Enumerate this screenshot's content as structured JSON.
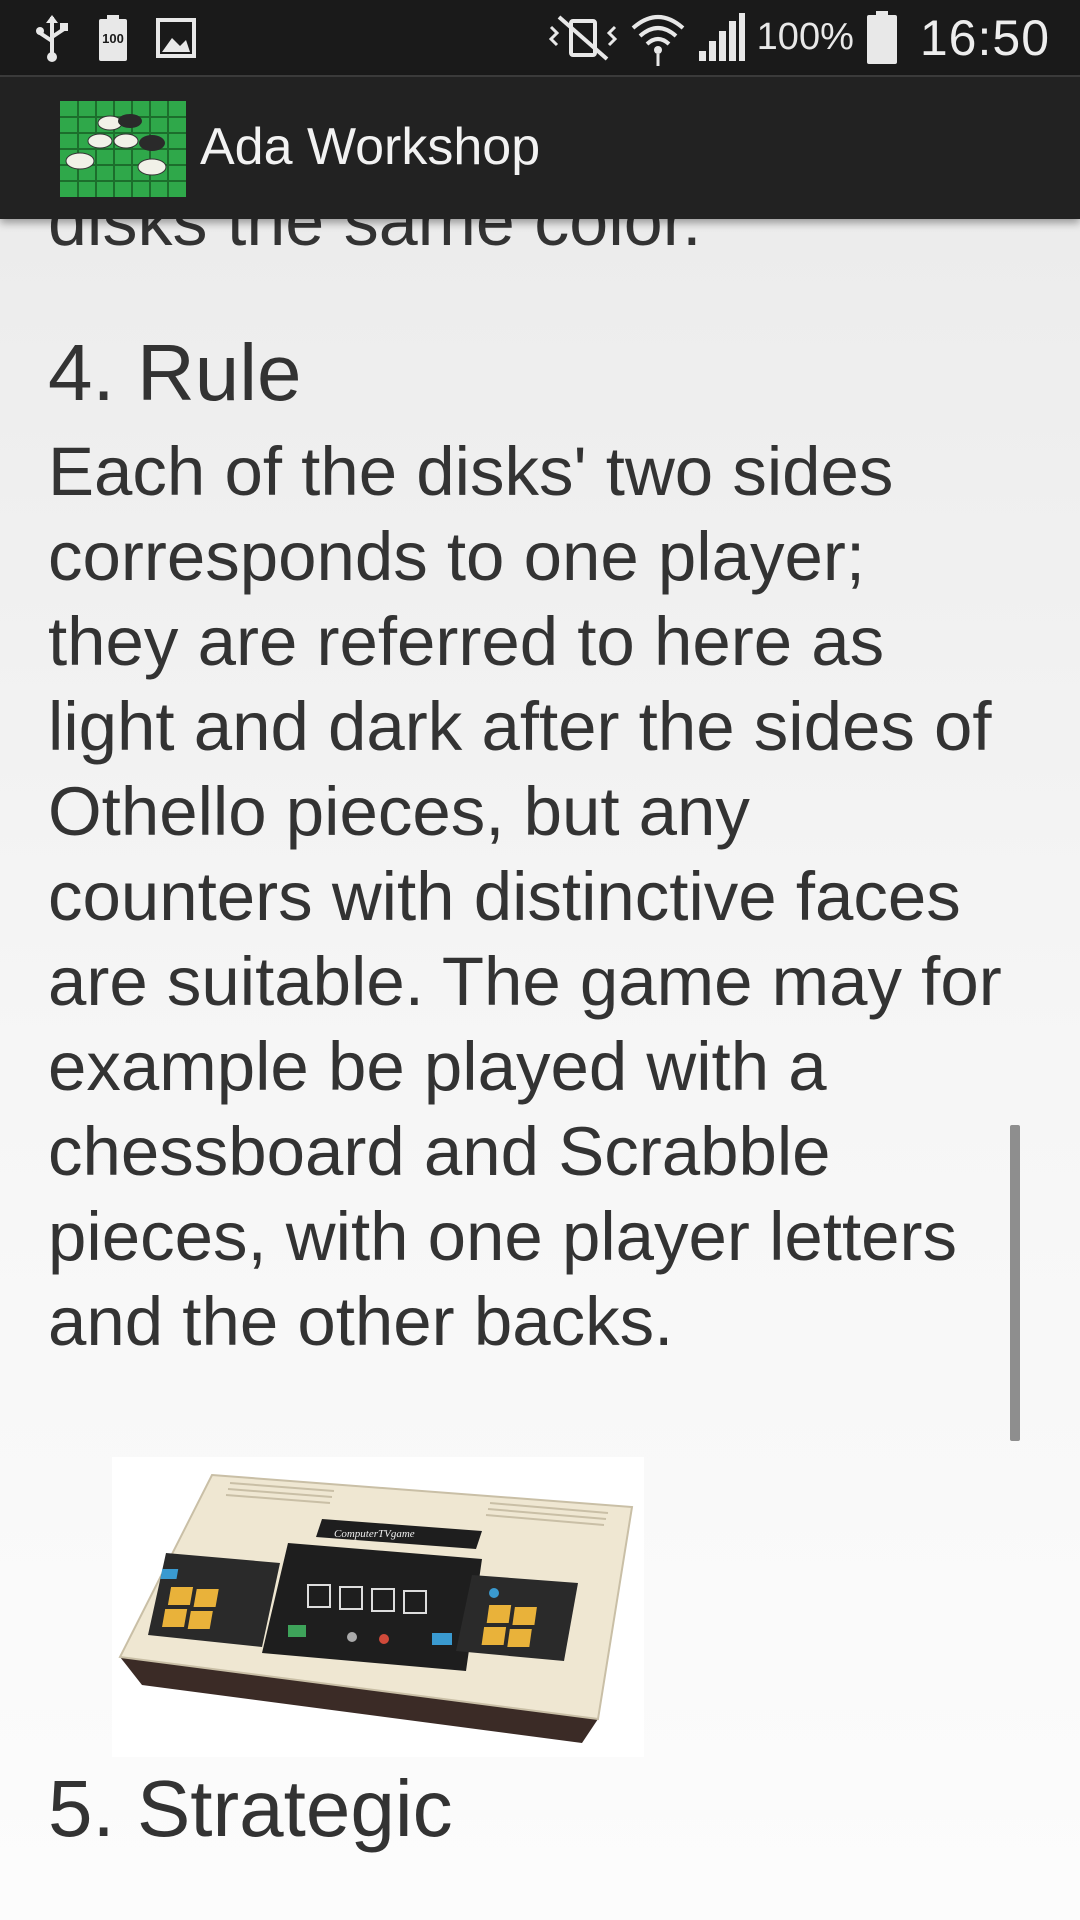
{
  "status_bar": {
    "left_icons": [
      "usb-icon",
      "battery-100-notification-icon",
      "image-icon"
    ],
    "right_icons": [
      "vibrate-mute-icon",
      "wifi-icon",
      "signal-icon"
    ],
    "battery_icon_label": "100",
    "battery_percent": "100%",
    "time": "16:50"
  },
  "action_bar": {
    "title": "Ada Workshop",
    "app_icon": "othello-board-icon"
  },
  "content": {
    "partial_previous_line": "disks the same color.",
    "section4_heading": "4. Rule",
    "section4_body": "Each of the disks' two sides corresponds to one player; they are referred to here as light and dark after the sides of Othello pieces, but any counters with distinctive faces are suitable. The game may for example be played with a chessboard and Scrabble pieces, with one player letters and the other backs.",
    "image_label": "ComputerTVgame",
    "section5_heading": "5. Strategic"
  }
}
